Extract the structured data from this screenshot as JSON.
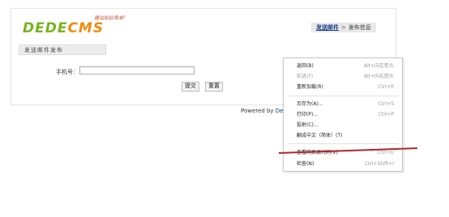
{
  "logo": {
    "slogan": "建站如此简单!",
    "word_dede": "DEDE",
    "word_cms": "CMS"
  },
  "breadcrumb": {
    "link": "发送邮件",
    "sep": ">",
    "current": "发布信息"
  },
  "section_tab": {
    "label": "发送邮件发布"
  },
  "form": {
    "phone_label": "手机号：",
    "phone_value": "",
    "submit_label": "提交",
    "reset_label": "重置"
  },
  "footer": {
    "powered_prefix": "Powered by ",
    "powered_link": "Dec"
  },
  "context_menu": {
    "items": [
      {
        "label": "返回(B)",
        "shortcut": "Alt+向左箭头"
      },
      {
        "label": "前进(F)",
        "shortcut": "Alt+向右箭头"
      },
      {
        "label": "重新加载(R)",
        "shortcut": "Ctrl+R"
      },
      {
        "label": "另存为(A)...",
        "shortcut": "Ctrl+S"
      },
      {
        "label": "打印(P)...",
        "shortcut": "Ctrl+P"
      },
      {
        "label": "投射(C)...",
        "shortcut": ""
      },
      {
        "label": "翻成中文（简体）(T)",
        "shortcut": ""
      },
      {
        "label": "查看网页源代码(V)",
        "shortcut": "Ctrl+U"
      },
      {
        "label": "检查(N)",
        "shortcut": "Ctrl+Shift+I"
      }
    ]
  },
  "colors": {
    "logo_green": "#77b31e",
    "logo_orange": "#f08a0a",
    "annotation_red": "#b3262a",
    "link_blue": "#1a3e8c"
  }
}
